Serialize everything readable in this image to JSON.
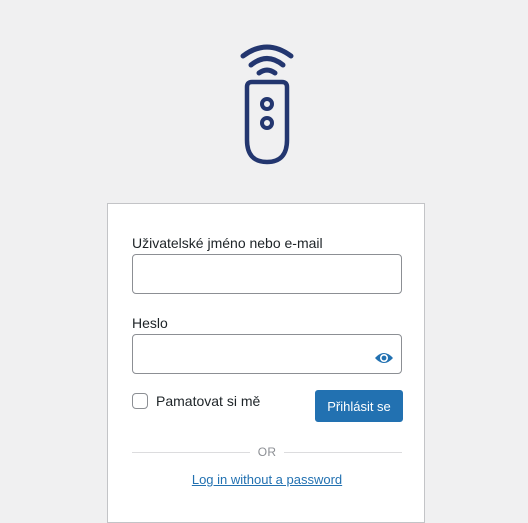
{
  "logo": {
    "icon": "remote-control-icon",
    "color": "#23366f"
  },
  "form": {
    "username_label": "Uživatelské jméno nebo e-mail",
    "username_value": "",
    "password_label": "Heslo",
    "password_value": "",
    "show_password_icon": "eye-icon",
    "remember_label": "Pamatovat si mě",
    "remember_checked": false,
    "submit_label": "Přihlásit se",
    "divider_text": "OR",
    "magic_link_label": "Log in without a password"
  },
  "colors": {
    "accent": "#2271b1",
    "background": "#f0f0f1"
  }
}
